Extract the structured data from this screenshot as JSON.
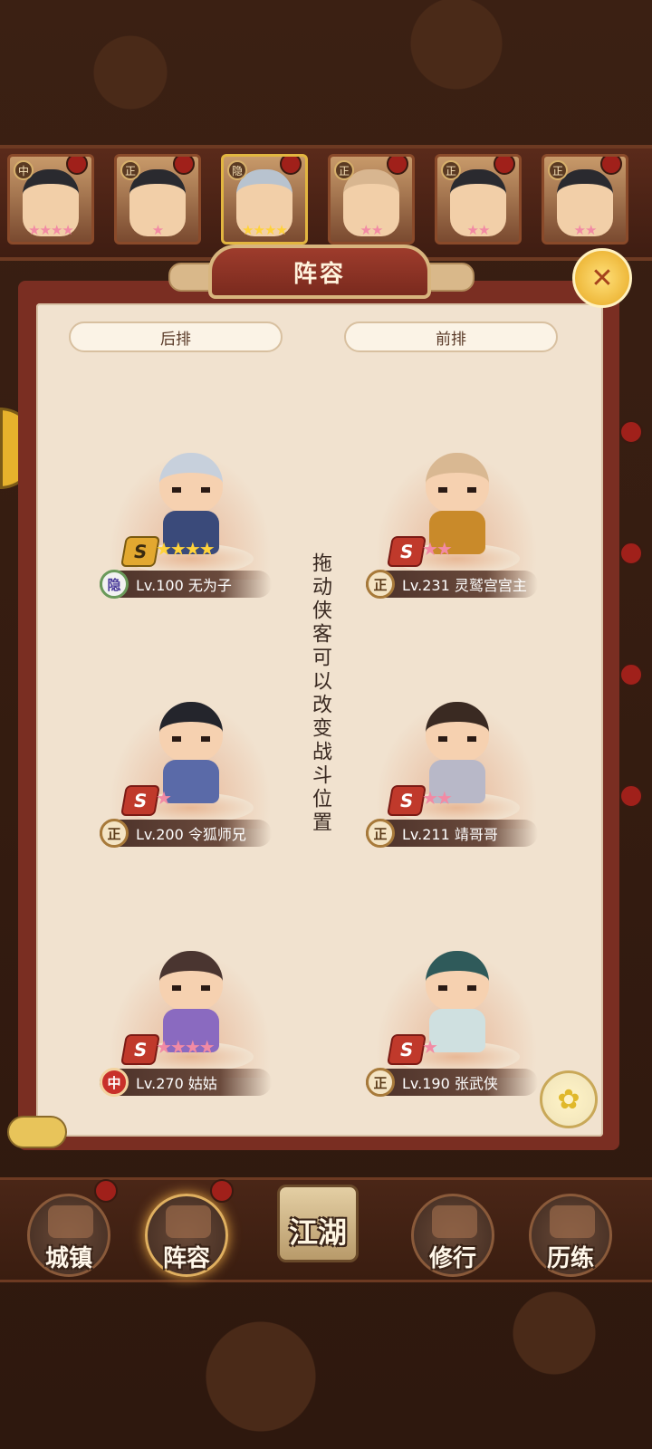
{
  "panel": {
    "title": "阵容",
    "close_icon": "sword-close-icon",
    "back_row_label": "后排",
    "front_row_label": "前排",
    "hint": "拖动侠客可以改变战斗位置"
  },
  "top_heroes": [
    {
      "tag": "中",
      "stars": "★★★★",
      "star_color": "pink",
      "hair": "black"
    },
    {
      "tag": "正",
      "stars": "★",
      "star_color": "pink",
      "hair": "black"
    },
    {
      "tag": "隐",
      "stars": "★★★★",
      "star_color": "gold",
      "hair": "silver"
    },
    {
      "tag": "正",
      "stars": "★★",
      "star_color": "pink",
      "hair": "bald"
    },
    {
      "tag": "正",
      "stars": "★★",
      "star_color": "pink",
      "hair": "black"
    },
    {
      "tag": "正",
      "stars": "★★",
      "star_color": "pink",
      "hair": "black"
    }
  ],
  "formation": {
    "back": [
      {
        "faction": "隐",
        "level_name": "Lv.100 无为子",
        "grade": "S",
        "stars": "★★★★",
        "star_color": "gold"
      },
      {
        "faction": "正",
        "level_name": "Lv.200 令狐师兄",
        "grade": "S",
        "stars": "★",
        "star_color": "pink"
      },
      {
        "faction": "中",
        "level_name": "Lv.270 姑姑",
        "grade": "S",
        "stars": "★★★★",
        "star_color": "pink"
      }
    ],
    "front": [
      {
        "faction": "正",
        "level_name": "Lv.231 灵鹫宫宫主",
        "grade": "S",
        "stars": "★★",
        "star_color": "pink"
      },
      {
        "faction": "正",
        "level_name": "Lv.211 靖哥哥",
        "grade": "S",
        "stars": "★★",
        "star_color": "pink"
      },
      {
        "faction": "正",
        "level_name": "Lv.190 张武侠",
        "grade": "S",
        "stars": "★",
        "star_color": "pink"
      }
    ]
  },
  "bottom_nav": {
    "town": "城镇",
    "lineup": "阵容",
    "jianghu": "江湖",
    "practice": "修行",
    "training": "历练"
  },
  "colors": {
    "panel_frame": "#7a2e22",
    "panel_paper": "#f1e2cf",
    "accent_gold": "#e7a821",
    "star_pink": "#f28aa4",
    "star_gold": "#ffd23a"
  }
}
